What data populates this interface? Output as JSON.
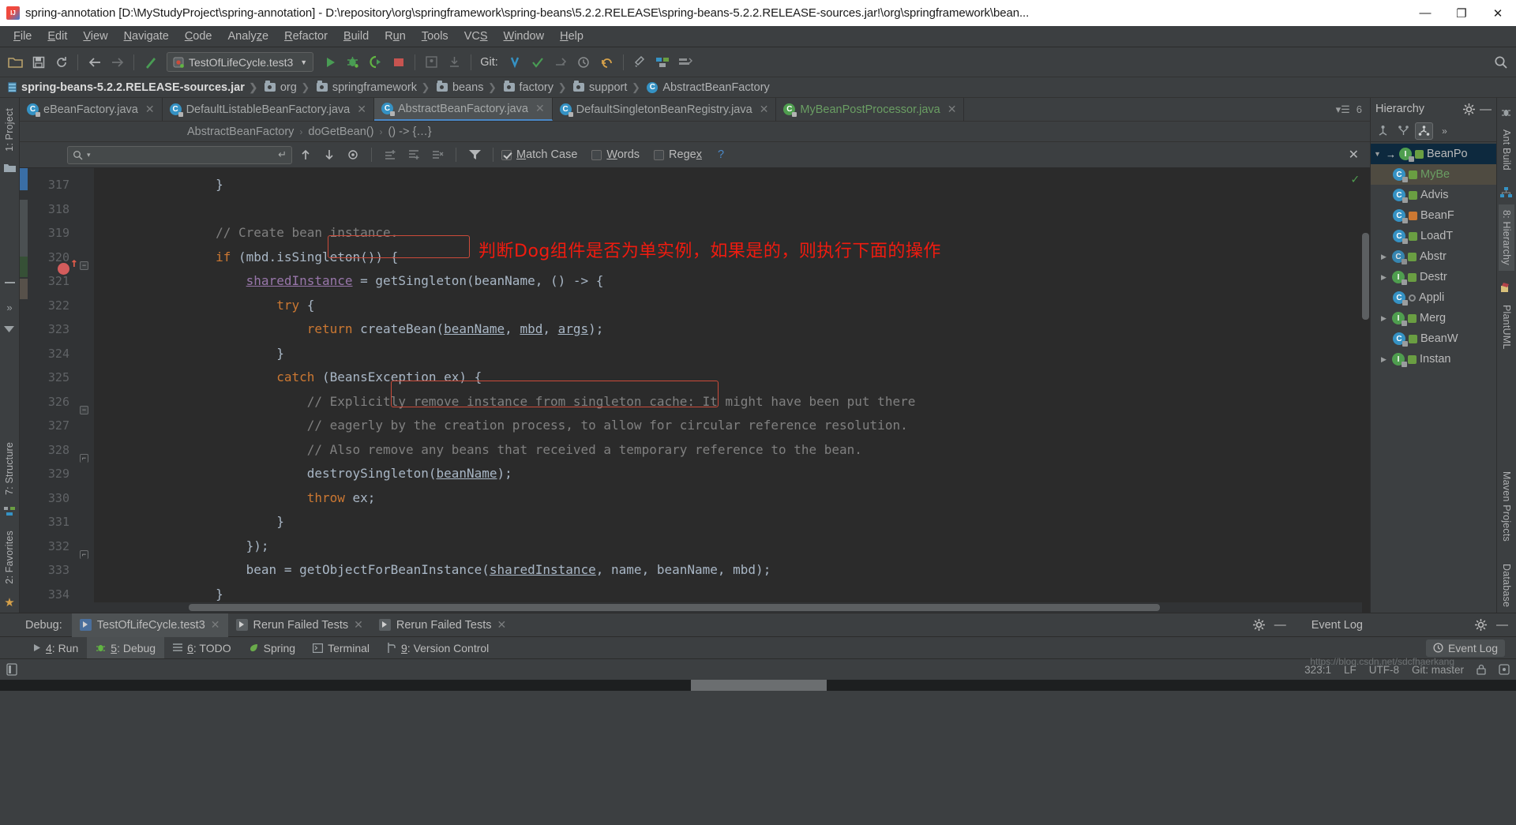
{
  "window": {
    "title": "spring-annotation [D:\\MyStudyProject\\spring-annotation] - D:\\repository\\org\\springframework\\spring-beans\\5.2.2.RELEASE\\spring-beans-5.2.2.RELEASE-sources.jar!\\org\\springframework\\bean...",
    "minimize": "—",
    "maximize": "❐",
    "close": "✕"
  },
  "menubar": {
    "items": [
      {
        "label": "File"
      },
      {
        "label": "Edit"
      },
      {
        "label": "View"
      },
      {
        "label": "Navigate"
      },
      {
        "label": "Code"
      },
      {
        "label": "Analyze"
      },
      {
        "label": "Refactor"
      },
      {
        "label": "Build"
      },
      {
        "label": "Run"
      },
      {
        "label": "Tools"
      },
      {
        "label": "VCS"
      },
      {
        "label": "Window"
      },
      {
        "label": "Help"
      }
    ]
  },
  "toolbar": {
    "run_config": "TestOfLifeCycle.test3",
    "run_config_caret": "▼",
    "git_label": "Git:",
    "icons": [
      "open-folder-icon",
      "save-all-icon",
      "sync-icon",
      "back-arrow-icon",
      "forward-arrow-icon",
      "build-icon",
      "run-icon",
      "debug-icon",
      "run-coverage-icon",
      "stop-icon",
      "profile-icon",
      "install-icon",
      "git-update-icon",
      "git-commit-icon",
      "git-push-icon",
      "git-history-icon",
      "git-revert-icon",
      "settings-icon",
      "project-structure-icon",
      "sdk-icon",
      "search-everywhere-icon"
    ]
  },
  "navbar": {
    "crumbs": [
      {
        "label": "spring-beans-5.2.2.RELEASE-sources.jar",
        "icon": "jar-icon"
      },
      {
        "label": "org",
        "icon": "folder-icon"
      },
      {
        "label": "springframework",
        "icon": "folder-icon"
      },
      {
        "label": "beans",
        "icon": "folder-icon"
      },
      {
        "label": "factory",
        "icon": "folder-icon"
      },
      {
        "label": "support",
        "icon": "folder-icon"
      },
      {
        "label": "AbstractBeanFactory",
        "icon": "class-icon"
      }
    ]
  },
  "left_strip": {
    "top_tabs": [
      {
        "label": "1: Project"
      }
    ],
    "bottom_tabs": [
      {
        "label": "7: Structure"
      },
      {
        "label": "2: Favorites"
      }
    ]
  },
  "right_strip": {
    "tabs": [
      {
        "label": "Maven Projects"
      },
      {
        "label": "Database"
      }
    ]
  },
  "hierarchy_strip": {
    "tabs": [
      {
        "label": "Ant Build"
      },
      {
        "label": "8: Hierarchy",
        "selected": true
      },
      {
        "label": "PlantUML"
      }
    ]
  },
  "editor_tabs": {
    "tabs": [
      {
        "label": "eBeanFactory.java",
        "icon": "java-class-icon",
        "active": false,
        "close": "✕",
        "truncated": true
      },
      {
        "label": "DefaultListableBeanFactory.java",
        "icon": "java-class-icon",
        "active": false,
        "close": "✕"
      },
      {
        "label": "AbstractBeanFactory.java",
        "icon": "java-class-icon",
        "active": true,
        "close": "✕"
      },
      {
        "label": "DefaultSingletonBeanRegistry.java",
        "icon": "java-class-icon",
        "active": false,
        "close": "✕"
      },
      {
        "label": "MyBeanPostProcessor.java",
        "icon": "java-class-icon-green",
        "active": false,
        "close": "✕",
        "green": true
      }
    ],
    "overflow_count": "6",
    "overflow_icon": "tab-list-icon"
  },
  "editor_breadcrumbs": {
    "items": [
      "AbstractBeanFactory",
      "doGetBean()",
      "() -> {…}"
    ],
    "separator": "›"
  },
  "find_bar": {
    "search_value": "",
    "search_placeholder": "",
    "search_icon": "search-icon",
    "history_caret": "▾",
    "enter_icon": "↵",
    "prev_icon": "↑",
    "next_icon": "↓",
    "select_all_icon": "select-all-occurrences-icon",
    "add_before_icon": "add-line-before-icon",
    "add_after_icon": "add-line-after-icon",
    "exclude_icon": "exclude-icon",
    "filter_icon": "filter-icon",
    "match_case": {
      "label": "Match Case",
      "checked": true
    },
    "words": {
      "label": "Words",
      "checked": false
    },
    "regex": {
      "label": "Regex",
      "checked": false
    },
    "help": "?",
    "close": "✕"
  },
  "code": {
    "first_line": 317,
    "lines": [
      {
        "n": 317,
        "tokens": [
          {
            "t": "                }",
            "c": "plain"
          }
        ]
      },
      {
        "n": 318,
        "tokens": [
          {
            "t": "",
            "c": "plain"
          }
        ]
      },
      {
        "n": 319,
        "tokens": [
          {
            "t": "                ",
            "c": "plain"
          },
          {
            "t": "// Create bean instance.",
            "c": "cmt"
          }
        ]
      },
      {
        "n": 320,
        "tokens": [
          {
            "t": "                ",
            "c": "plain"
          },
          {
            "t": "if",
            "c": "kw"
          },
          {
            "t": " (mbd.isSingleton()) {",
            "c": "plain"
          }
        ]
      },
      {
        "n": 321,
        "tokens": [
          {
            "t": "                    ",
            "c": "plain"
          },
          {
            "t": "sharedInstance",
            "c": "fld"
          },
          {
            "t": " = getSingleton(beanName, () -> {",
            "c": "plain"
          }
        ]
      },
      {
        "n": 322,
        "tokens": [
          {
            "t": "                        ",
            "c": "plain"
          },
          {
            "t": "try",
            "c": "kw"
          },
          {
            "t": " {",
            "c": "plain"
          }
        ]
      },
      {
        "n": 323,
        "tokens": [
          {
            "t": "                            ",
            "c": "plain"
          },
          {
            "t": "return",
            "c": "kw"
          },
          {
            "t": " createBean(",
            "c": "plain"
          },
          {
            "t": "beanName",
            "c": "par"
          },
          {
            "t": ", ",
            "c": "plain"
          },
          {
            "t": "mbd",
            "c": "par"
          },
          {
            "t": ", ",
            "c": "plain"
          },
          {
            "t": "args",
            "c": "par"
          },
          {
            "t": ");",
            "c": "plain"
          }
        ]
      },
      {
        "n": 324,
        "tokens": [
          {
            "t": "                        }",
            "c": "plain"
          }
        ]
      },
      {
        "n": 325,
        "tokens": [
          {
            "t": "                        ",
            "c": "plain"
          },
          {
            "t": "catch",
            "c": "kw"
          },
          {
            "t": " (BeansException ex) {",
            "c": "plain"
          }
        ]
      },
      {
        "n": 326,
        "tokens": [
          {
            "t": "                            ",
            "c": "plain"
          },
          {
            "t": "// Explicitly remove instance from singleton cache: It might have been put there",
            "c": "cmt"
          }
        ]
      },
      {
        "n": 327,
        "tokens": [
          {
            "t": "                            ",
            "c": "plain"
          },
          {
            "t": "// eagerly by the creation process, to allow for circular reference resolution.",
            "c": "cmt"
          }
        ]
      },
      {
        "n": 328,
        "tokens": [
          {
            "t": "                            ",
            "c": "plain"
          },
          {
            "t": "// Also remove any beans that received a temporary reference to the bean.",
            "c": "cmt"
          }
        ]
      },
      {
        "n": 329,
        "tokens": [
          {
            "t": "                            destroySingleton(",
            "c": "plain"
          },
          {
            "t": "beanName",
            "c": "par"
          },
          {
            "t": ");",
            "c": "plain"
          }
        ]
      },
      {
        "n": 330,
        "tokens": [
          {
            "t": "                            ",
            "c": "plain"
          },
          {
            "t": "throw",
            "c": "kw"
          },
          {
            "t": " ex;",
            "c": "plain"
          }
        ]
      },
      {
        "n": 331,
        "tokens": [
          {
            "t": "                        }",
            "c": "plain"
          }
        ]
      },
      {
        "n": 332,
        "tokens": [
          {
            "t": "                    });",
            "c": "plain"
          }
        ]
      },
      {
        "n": 333,
        "tokens": [
          {
            "t": "                    bean = getObjectForBeanInstance(",
            "c": "plain"
          },
          {
            "t": "sharedInstance",
            "c": "par"
          },
          {
            "t": ", name, beanName, mbd);",
            "c": "plain"
          }
        ]
      },
      {
        "n": 334,
        "tokens": [
          {
            "t": "                }",
            "c": "plain"
          }
        ]
      }
    ],
    "annotation_text": "判断Dog组件是否为单实例，如果是的，则执行下面的操作",
    "annotation_color": "#f01b0f",
    "highlight_color": "#cc4b3a",
    "breakpoint_line": 321,
    "inspection_status_icon": "ok-check-icon"
  },
  "hierarchy": {
    "title": "Hierarchy",
    "settings_icon": "gear-icon",
    "minimize_icon": "minimize-icon",
    "tools": [
      {
        "name": "supertypes-icon",
        "selected": false
      },
      {
        "name": "subtypes-icon",
        "selected": false
      },
      {
        "name": "both-types-icon",
        "selected": true
      },
      {
        "name": "more-icon",
        "label": "»",
        "selected": false
      }
    ],
    "rows": [
      {
        "label": "BeanPo",
        "indent": 0,
        "tri": "▼",
        "icon": "interface-icon",
        "sel": "root"
      },
      {
        "label": "MyBe",
        "indent": 1,
        "tri": "",
        "icon": "class-icon",
        "sel": "child",
        "green": true
      },
      {
        "label": "Advis",
        "indent": 1,
        "tri": "",
        "icon": "class-icon"
      },
      {
        "label": "BeanF",
        "indent": 1,
        "tri": "",
        "icon": "class-icon",
        "keycolor": "orange"
      },
      {
        "label": "LoadT",
        "indent": 1,
        "tri": "",
        "icon": "class-icon"
      },
      {
        "label": "Abstr",
        "indent": 1,
        "tri": "▶",
        "icon": "abstract-class-icon"
      },
      {
        "label": "Destr",
        "indent": 1,
        "tri": "▶",
        "icon": "interface-icon"
      },
      {
        "label": "Appli",
        "indent": 1,
        "tri": "",
        "icon": "class-icon",
        "keycolor": "dot"
      },
      {
        "label": "Merg",
        "indent": 1,
        "tri": "▶",
        "icon": "interface-icon"
      },
      {
        "label": "BeanW",
        "indent": 1,
        "tri": "",
        "icon": "class-icon"
      },
      {
        "label": "Instan",
        "indent": 1,
        "tri": "▶",
        "icon": "interface-icon"
      }
    ]
  },
  "debug_panel": {
    "label": "Debug:",
    "tabs": [
      {
        "label": "TestOfLifeCycle.test3",
        "icon": "run-test-icon",
        "active": true,
        "close": "✕"
      },
      {
        "label": "Rerun Failed Tests",
        "icon": "rerun-icon",
        "active": false,
        "close": "✕"
      },
      {
        "label": "Rerun Failed Tests",
        "icon": "rerun-icon",
        "active": false,
        "close": "✕"
      }
    ],
    "settings_icon": "gear-icon",
    "hide_icon": "minimize-icon",
    "event_log_title": "Event Log",
    "event_log_settings_icon": "gear-icon",
    "event_log_hide_icon": "minimize-icon"
  },
  "bottom_bar": {
    "tabs": [
      {
        "label": "4: Run",
        "icon": "run-icon",
        "active": false
      },
      {
        "label": "5: Debug",
        "icon": "debug-icon",
        "active": true
      },
      {
        "label": "6: TODO",
        "icon": "todo-icon",
        "active": false
      },
      {
        "label": "Spring",
        "icon": "spring-leaf-icon",
        "active": false
      },
      {
        "label": "Terminal",
        "icon": "terminal-icon",
        "active": false
      },
      {
        "label": "9: Version Control",
        "icon": "vcs-icon",
        "active": false
      }
    ],
    "event_log": {
      "label": "Event Log",
      "icon": "clock-icon"
    }
  },
  "status_bar": {
    "memory_icon": "layout-icon",
    "caret_position": "323:1",
    "line_separator": "LF",
    "encoding": "UTF-8",
    "branch": "Git: master",
    "lock_icon": "lock-icon",
    "inspection_icon": "inspections-icon",
    "watermark": "https://blog.csdn.net/sdcfhaerkang"
  }
}
